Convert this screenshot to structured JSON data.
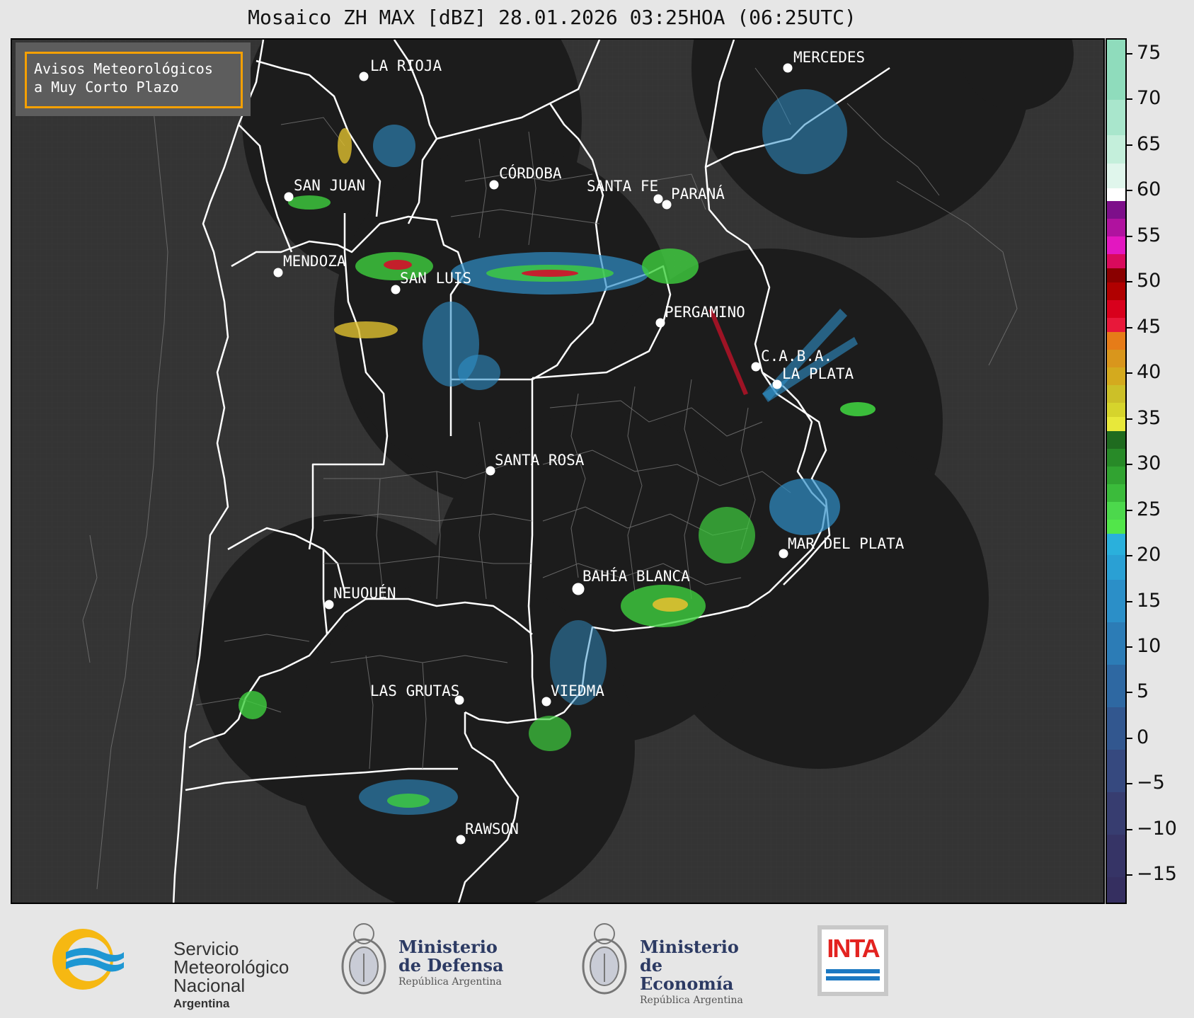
{
  "title": "Mosaico ZH MAX [dBZ] 28.01.2026 03:25HOA (06:25UTC)",
  "badge": {
    "line1": "Avisos Meteorológicos",
    "line2": "a Muy Corto Plazo",
    "border_color": "#f5a000"
  },
  "cities": [
    {
      "name": "LA RIOJA"
    },
    {
      "name": "MERCEDES"
    },
    {
      "name": "CÓRDOBA"
    },
    {
      "name": "SAN JUAN"
    },
    {
      "name": "SANTA FE"
    },
    {
      "name": "PARANÁ"
    },
    {
      "name": "MENDOZA"
    },
    {
      "name": "SAN LUIS"
    },
    {
      "name": "PERGAMINO"
    },
    {
      "name": "C.A.B.A."
    },
    {
      "name": "LA PLATA"
    },
    {
      "name": "SANTA ROSA"
    },
    {
      "name": "MAR DEL PLATA"
    },
    {
      "name": "BAHÍA BLANCA"
    },
    {
      "name": "NEUQUÉN"
    },
    {
      "name": "LAS GRUTAS"
    },
    {
      "name": "VIEDMA"
    },
    {
      "name": "RAWSON"
    }
  ],
  "colorbar": {
    "unit": "dBZ",
    "ticks": [
      "75",
      "70",
      "65",
      "60",
      "55",
      "50",
      "45",
      "40",
      "35",
      "30",
      "25",
      "20",
      "15",
      "10",
      "5",
      "0",
      "−5",
      "−10",
      "−15"
    ],
    "range": [
      -18,
      77
    ]
  },
  "logos": {
    "smn": {
      "line1": "Servicio",
      "line2": "Meteorológico",
      "line3": "Nacional",
      "country": "Argentina"
    },
    "defensa": {
      "line1": "Ministerio",
      "line2": "de Defensa",
      "sub": "República Argentina"
    },
    "economia": {
      "line1": "Ministerio",
      "line2": "de Economía",
      "sub": "República Argentina"
    },
    "inta": {
      "label": "INTA"
    }
  },
  "colors": {
    "background": "#e6e6e6",
    "map_bg": "#333333",
    "radar_disk": "#1c1c1c",
    "border": "#ffffff"
  }
}
